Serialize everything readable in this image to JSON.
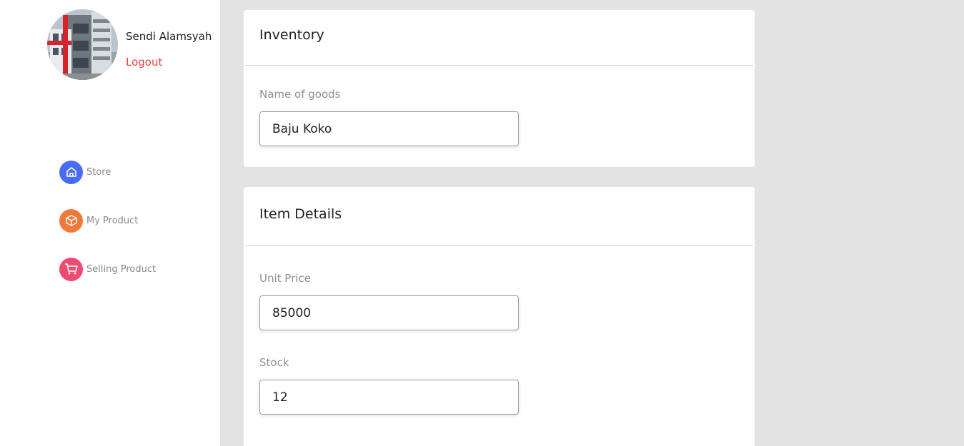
{
  "user": {
    "name": "Sendi Alamsyah",
    "logout_label": "Logout"
  },
  "nav": {
    "items": [
      {
        "label": "Store",
        "icon": "home-icon",
        "color": "#4a6cf0"
      },
      {
        "label": "My Product",
        "icon": "box-icon",
        "color": "#f07838"
      },
      {
        "label": "Selling Product",
        "icon": "cart-icon",
        "color": "#ef4a6f"
      }
    ]
  },
  "inventory": {
    "title": "Inventory",
    "name_label": "Name of goods",
    "name_value": "Baju Koko"
  },
  "item_details": {
    "title": "Item Details",
    "price_label": "Unit Price",
    "price_value": "85000",
    "stock_label": "Stock",
    "stock_value": "12"
  }
}
